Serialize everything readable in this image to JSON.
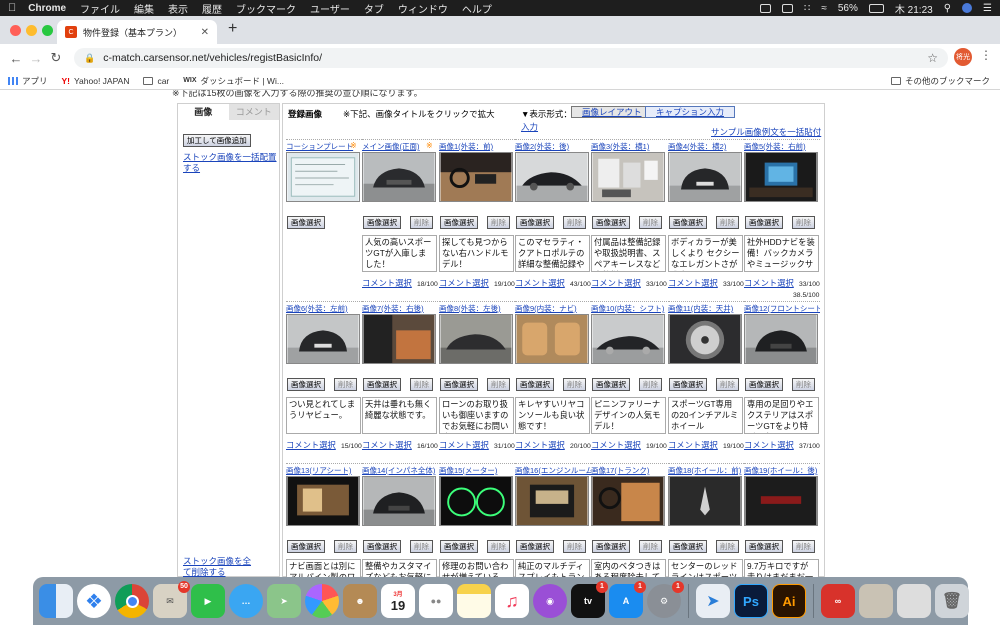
{
  "menubar": {
    "app": "Chrome",
    "items": [
      "ファイル",
      "編集",
      "表示",
      "履歴",
      "ブックマーク",
      "ユーザー",
      "タブ",
      "ウィンドウ",
      "ヘルプ"
    ],
    "battery": "56%",
    "clock": "木 21:23"
  },
  "browser": {
    "tab_title": "物件登録（基本プラン）",
    "url": "c-match.carsensor.net/vehicles/registBasicInfo/",
    "avatar_label": "将光"
  },
  "bookmarks": {
    "items": [
      "アプリ",
      "Yahoo! JAPAN",
      "car",
      "ダッシュボード | Wi..."
    ],
    "other": "その他のブックマーク"
  },
  "page": {
    "clipped_notice": "※下記は15枚の画像を入力する際の推奨の並び順になります。",
    "left_tabs": [
      "画像",
      "コメント"
    ],
    "add_button": "加工して画像追加",
    "stock_all_link": "ストック画像を一括配置する",
    "stock_delete_link": "ストック画像を全て削除する",
    "header_title": "登録画像",
    "header_note": "※下記、画像タイトルをクリックで拡大",
    "display_label": "▼表示形式：",
    "toggle_layout": "画像レイアウト",
    "toggle_caption": "キャプション入力",
    "sample_link": "サンプル画像例文を一括貼付",
    "select_label": "画像選択",
    "delete_label": "削除",
    "comment_select_label": "コメント選択",
    "total_counter": "38.5/100",
    "colors": {
      "link": "#1a44bb",
      "accent_mark": "#ff8800"
    }
  },
  "rows": [
    {
      "items": [
        {
          "label": "コーションプレート",
          "mark": "※",
          "kind": "plate",
          "btn_delete": false,
          "comment": null,
          "counter": null
        },
        {
          "label": "メイン画像(正面)",
          "mark": "※",
          "kind": "front",
          "btn_delete": true,
          "comment": "人気の高いスポーツGTが入庫しました！",
          "counter": "18/100"
        },
        {
          "label": "画像1(外装：前)",
          "mark": "",
          "kind": "interior-dash",
          "btn_delete": true,
          "comment": "探しても見つからない右ハンドルモデル！",
          "counter": "19/100"
        },
        {
          "label": "画像2(外装：後)",
          "mark": "",
          "kind": "side",
          "btn_delete": true,
          "comment": "このマセラティ・クアトロポルテの詳細な整備記録やオシャ",
          "counter": "43/100"
        },
        {
          "label": "画像3(外装：横1)",
          "mark": "",
          "kind": "docs",
          "btn_delete": true,
          "comment": "付属品は整備記録や取扱説明書、スペアキーレスなど多数揃",
          "counter": "33/100"
        },
        {
          "label": "画像4(外装：横2)",
          "mark": "",
          "kind": "rear",
          "btn_delete": true,
          "comment": "ボディカラーが美しくより セクシーなエレガントさが際立つ",
          "counter": "33/100"
        },
        {
          "label": "画像5(外装：右前)",
          "mark": "",
          "kind": "nav",
          "btn_delete": true,
          "comment": "社外HDDナビを装備！バックカメラやミュージックサーバ",
          "counter": "33/100"
        }
      ]
    },
    {
      "items": [
        {
          "label": "画像6(外装：左前)",
          "mark": "",
          "kind": "rear",
          "btn_delete": true,
          "comment": "つい見とれてしまうリヤビュー。",
          "counter": "15/100"
        },
        {
          "label": "画像7(外装：右後)",
          "mark": "",
          "kind": "door-interior",
          "btn_delete": true,
          "comment": "天井は垂れも無く綺麗な状態です。",
          "counter": "16/100"
        },
        {
          "label": "画像8(外装：左後)",
          "mark": "",
          "kind": "garage-car",
          "btn_delete": true,
          "comment": "ローンのお取り扱いも御座いますのでお気軽にお問い合わせ",
          "counter": "31/100"
        },
        {
          "label": "画像9(内装：ナビ)",
          "mark": "",
          "kind": "tan-seats",
          "btn_delete": true,
          "comment": "キレヤすいリヤコンソールも良い状態です！",
          "counter": "20/100"
        },
        {
          "label": "画像10(内装：シフト)",
          "mark": "",
          "kind": "side-dark",
          "btn_delete": true,
          "comment": "ピニンファリーナデザインの人気モデル！",
          "counter": "19/100"
        },
        {
          "label": "画像11(内装：天井)",
          "mark": "",
          "kind": "wheel",
          "btn_delete": true,
          "comment": "スポーツGT専用の20インチアルミホイール",
          "counter": "19/100"
        },
        {
          "label": "画像12(フロントシート)",
          "mark": "",
          "kind": "front-dark",
          "btn_delete": true,
          "comment": "専用の足回りやエクステリアはスポーツGTをより特別な車",
          "counter": "37/100"
        }
      ]
    },
    {
      "items": [
        {
          "label": "画像13(リアシート)",
          "mark": "",
          "kind": "screen",
          "btn_delete": true,
          "comment": "ナビ画面とは別にアルパイン製のワイド",
          "counter": null
        },
        {
          "label": "画像14(インパネ全体)",
          "mark": "",
          "kind": "front-dark",
          "btn_delete": true,
          "comment": "整備やカスタマイズなどもお気軽にお問",
          "counter": null
        },
        {
          "label": "画像15(メーター)",
          "mark": "",
          "kind": "meter",
          "btn_delete": true,
          "comment": "修理のお問い合わせが増えているTPMS",
          "counter": null
        },
        {
          "label": "画像16(エンジンルーム)",
          "mark": "",
          "kind": "stereo",
          "btn_delete": true,
          "comment": "純正のマルチディスプレイもトランクで",
          "counter": null
        },
        {
          "label": "画像17(トランク)",
          "mark": "",
          "kind": "interior-tan",
          "btn_delete": true,
          "comment": "室内のベタつきはある程度除去して有り",
          "counter": null
        },
        {
          "label": "画像18(ホイール：前)",
          "mark": "",
          "kind": "logo",
          "btn_delete": true,
          "comment": "センターのレッドラインはスポーツGT",
          "counter": null
        },
        {
          "label": "画像19(ホイール：後)",
          "mark": "",
          "kind": "badge-dark",
          "btn_delete": true,
          "comment": "9.7万キロですが走りはまだまだ一級",
          "counter": null
        }
      ]
    }
  ],
  "dock": {
    "mail_badge": "50",
    "calendar_month": "3月",
    "calendar_day": "19",
    "tv_label": "tv",
    "badges": {
      "appletv": "1",
      "appstore": "1",
      "prefs": "1"
    }
  }
}
